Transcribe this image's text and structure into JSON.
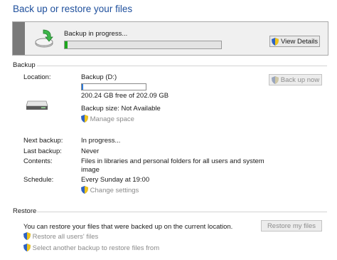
{
  "page": {
    "title": "Back up or restore your files"
  },
  "status": {
    "text": "Backup in progress...",
    "progress_fraction": 0.02,
    "view_details_label": "View Details"
  },
  "backup": {
    "heading": "Backup",
    "location_label": "Location:",
    "location_value": "Backup (D:)",
    "disk_used_fraction": 0.01,
    "free_text": "200.24 GB free of 202.09 GB",
    "size_text": "Backup size: Not Available",
    "manage_space": "Manage space",
    "back_up_now": "Back up now",
    "next_label": "Next backup:",
    "next_value": "In progress...",
    "last_label": "Last backup:",
    "last_value": "Never",
    "contents_label": "Contents:",
    "contents_line1": "Files in libraries and personal folders for all users and system",
    "contents_line2": "image",
    "schedule_label": "Schedule:",
    "schedule_value": "Every Sunday at 19:00",
    "change_settings": "Change settings"
  },
  "restore": {
    "heading": "Restore",
    "description": "You can restore your files that were backed up on the current location.",
    "restore_my_files": "Restore my files",
    "restore_all_users": "Restore all users' files",
    "select_another": "Select another backup to restore files from"
  },
  "colors": {
    "title": "#1e4f9c",
    "progress": "#1ca61c",
    "link": "#8a8a8a"
  }
}
